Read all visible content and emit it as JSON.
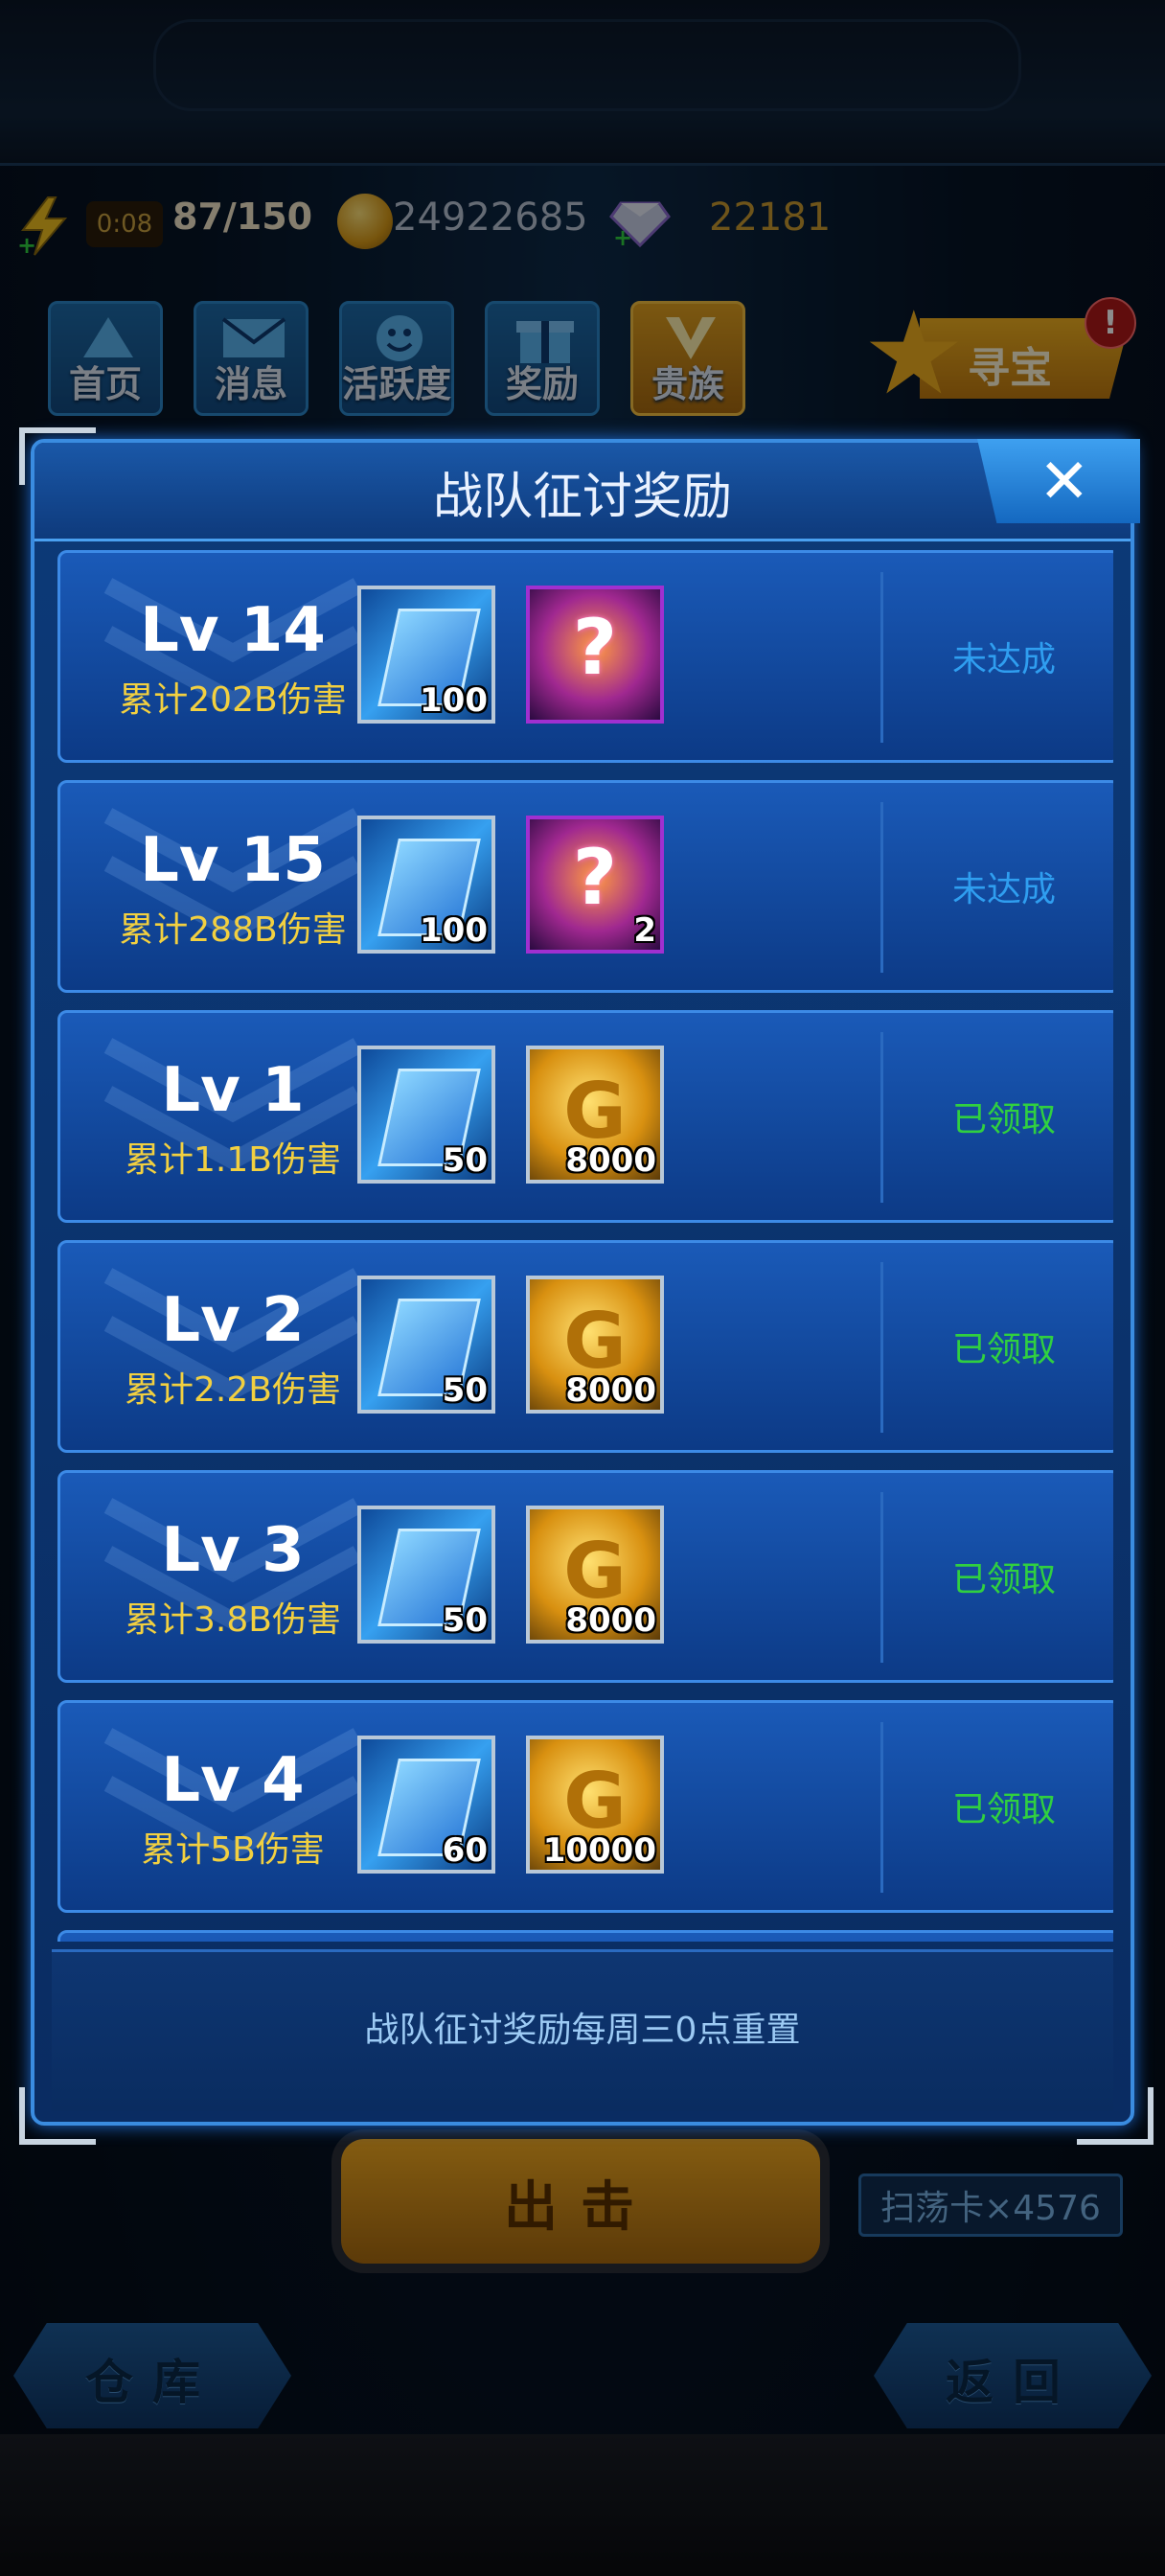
{
  "hud": {
    "energy_timer": "0:08",
    "energy": "87/150",
    "coins": "24922685",
    "gems": "22181"
  },
  "nav": [
    {
      "label": "首页",
      "icon": "home-icon"
    },
    {
      "label": "消息",
      "icon": "mail-icon"
    },
    {
      "label": "活跃度",
      "icon": "activity-icon"
    },
    {
      "label": "奖励",
      "icon": "gift-icon"
    },
    {
      "label": "贵族",
      "icon": "noble-icon"
    }
  ],
  "treasure": {
    "label": "寻宝",
    "badge": "!"
  },
  "dialog": {
    "title": "战队征讨奖励",
    "footer": "战队征讨奖励每周三0点重置",
    "rows": [
      {
        "level": "Lv 14",
        "damage": "累计202B伤害",
        "reward1_qty": "100",
        "reward2_type": "mystery-box",
        "reward2_qty": "",
        "status": "未达成",
        "status_color": "#2f9ef0"
      },
      {
        "level": "Lv 15",
        "damage": "累计288B伤害",
        "reward1_qty": "100",
        "reward2_type": "mystery-box",
        "reward2_qty": "2",
        "status": "未达成",
        "status_color": "#2f9ef0"
      },
      {
        "level": "Lv 1",
        "damage": "累计1.1B伤害",
        "reward1_qty": "50",
        "reward2_type": "gold-coin",
        "reward2_qty": "8000",
        "status": "已领取",
        "status_color": "#30d040"
      },
      {
        "level": "Lv 2",
        "damage": "累计2.2B伤害",
        "reward1_qty": "50",
        "reward2_type": "gold-coin",
        "reward2_qty": "8000",
        "status": "已领取",
        "status_color": "#30d040"
      },
      {
        "level": "Lv 3",
        "damage": "累计3.8B伤害",
        "reward1_qty": "50",
        "reward2_type": "gold-coin",
        "reward2_qty": "8000",
        "status": "已领取",
        "status_color": "#30d040"
      },
      {
        "level": "Lv 4",
        "damage": "累计5B伤害",
        "reward1_qty": "60",
        "reward2_type": "gold-coin",
        "reward2_qty": "10000",
        "status": "已领取",
        "status_color": "#30d040"
      }
    ]
  },
  "bottom": {
    "attack": "出击",
    "sweep": "扫荡卡×4576",
    "warehouse": "仓库",
    "back": "返回"
  }
}
